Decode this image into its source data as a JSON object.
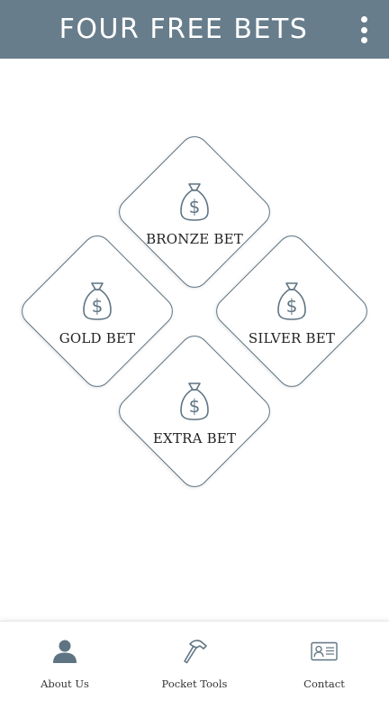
{
  "header": {
    "title": "FOUR FREE BETS",
    "menu_icon": "more-vertical-icon",
    "background": "#687d8b"
  },
  "tiles": [
    {
      "label": "BRONZE BET",
      "icon": "money-bag-icon"
    },
    {
      "label": "GOLD BET",
      "icon": "money-bag-icon"
    },
    {
      "label": "SILVER BET",
      "icon": "money-bag-icon"
    },
    {
      "label": "EXTRA BET",
      "icon": "money-bag-icon"
    }
  ],
  "bottom_nav": [
    {
      "label": "About Us",
      "icon": "person-icon"
    },
    {
      "label": "Pocket Tools",
      "icon": "hammer-icon"
    },
    {
      "label": "Contact",
      "icon": "contact-card-icon"
    }
  ],
  "colors": {
    "accent": "#687d8b",
    "tile_border": "#5f7482",
    "icon": "#5f7482"
  }
}
